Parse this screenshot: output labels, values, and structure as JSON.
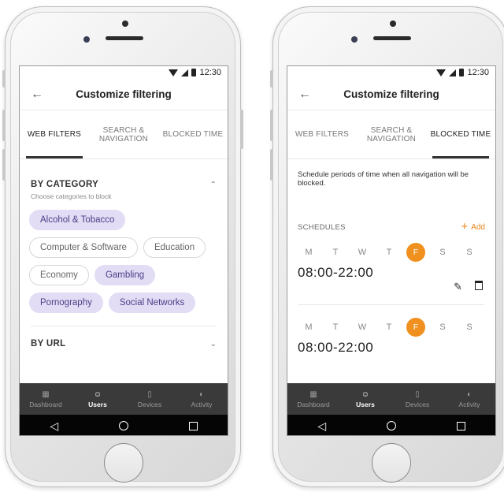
{
  "status": {
    "time": "12:30"
  },
  "appbar": {
    "title": "Customize filtering",
    "back_icon": "arrow-left-icon"
  },
  "tabs": [
    {
      "label": "WEB FILTERS"
    },
    {
      "label_line1": "SEARCH &",
      "label_line2": "NAVIGATION"
    },
    {
      "label": "BLOCKED TIME"
    }
  ],
  "web_filters": {
    "category_title": "BY CATEGORY",
    "category_subtitle": "Choose categories to block",
    "chips": [
      {
        "label": "Alcohol & Tobacco",
        "selected": true
      },
      {
        "label": "Computer & Software",
        "selected": false
      },
      {
        "label": "Education",
        "selected": false
      },
      {
        "label": "Economy",
        "selected": false
      },
      {
        "label": "Gambling",
        "selected": true
      },
      {
        "label": "Pornography",
        "selected": true
      },
      {
        "label": "Social Networks",
        "selected": true
      }
    ],
    "url_title": "BY URL"
  },
  "blocked_time": {
    "description": "Schedule periods of time when all navigation will be blocked.",
    "schedules_title": "SCHEDULES",
    "add_label": "Add",
    "days": [
      "M",
      "T",
      "W",
      "T",
      "F",
      "S",
      "S"
    ],
    "schedules": [
      {
        "time": "08:00-22:00",
        "active_day": "F"
      },
      {
        "time": "08:00-22:00",
        "active_day": "F"
      }
    ]
  },
  "bottom_nav": [
    {
      "label": "Dashboard",
      "icon": "grid-icon"
    },
    {
      "label": "Users",
      "icon": "users-icon",
      "active": true
    },
    {
      "label": "Devices",
      "icon": "phone-icon"
    },
    {
      "label": "Activity",
      "icon": "pie-chart-icon"
    }
  ],
  "colors": {
    "accent": "#f0901e",
    "chip_selected_bg": "#e3dcf5",
    "chip_selected_text": "#4a3f86",
    "nav_bg": "#3a3a3a"
  }
}
